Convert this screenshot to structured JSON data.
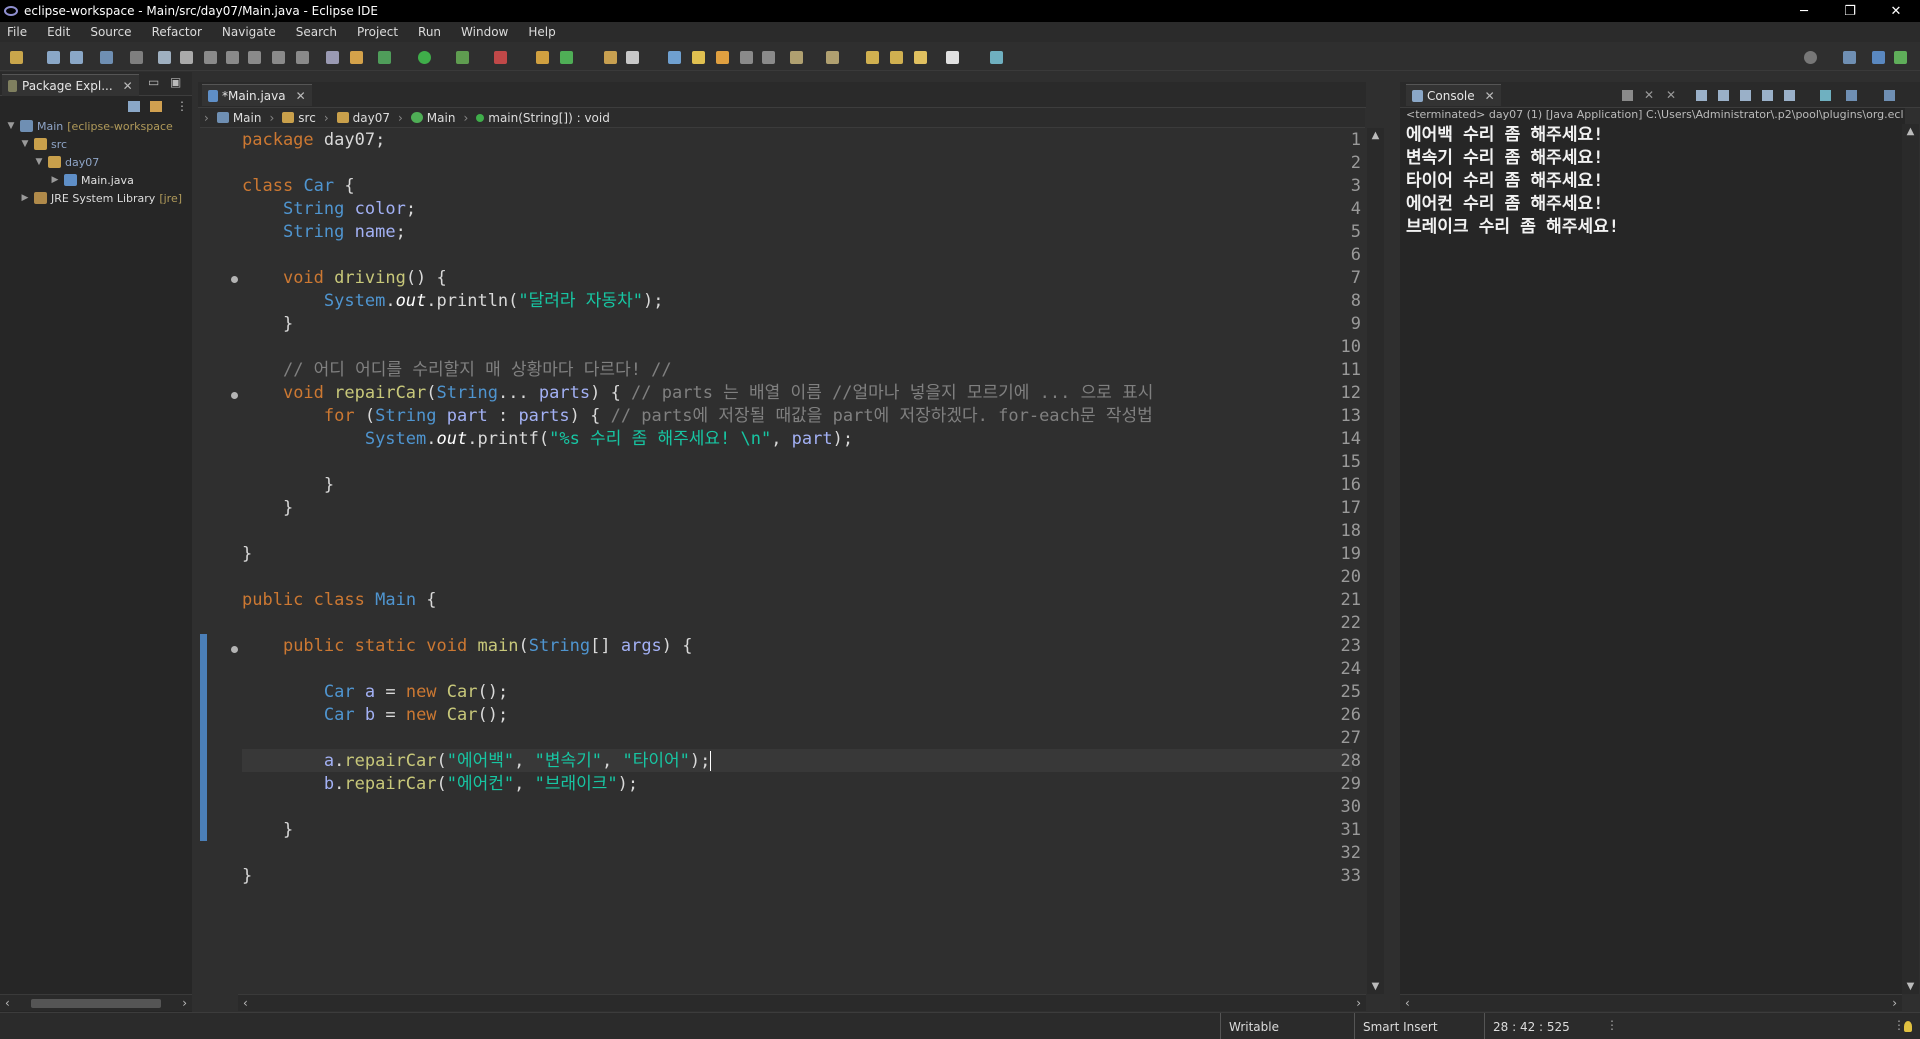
{
  "window": {
    "title": "eclipse-workspace - Main/src/day07/Main.java - Eclipse IDE",
    "minimize_glyph": "─",
    "restore_glyph": "❐",
    "close_glyph": "✕"
  },
  "menu": [
    "File",
    "Edit",
    "Source",
    "Refactor",
    "Navigate",
    "Search",
    "Project",
    "Run",
    "Window",
    "Help"
  ],
  "package_explorer": {
    "tab_label": "Package Expl...",
    "tree": [
      {
        "label": "Main",
        "suffix": "[eclipse-workspace",
        "icon": "project-icon"
      },
      {
        "label": "src",
        "icon": "source-folder-icon"
      },
      {
        "label": "day07",
        "icon": "package-icon"
      },
      {
        "label": "Main.java",
        "icon": "java-file-icon"
      },
      {
        "label": "JRE System Library",
        "suffix": "[jre]",
        "icon": "library-icon"
      }
    ]
  },
  "editor": {
    "tab_label": "*Main.java",
    "breadcrumb": [
      "Main",
      "src",
      "day07",
      "Main",
      "main(String[]) : void"
    ],
    "current_line": 28
  },
  "console": {
    "tab_label": "Console",
    "header": "<terminated> day07 (1) [Java Application] C:\\Users\\Administrator\\.p2\\pool\\plugins\\org.ecl",
    "output": [
      "에어백 수리 좀 해주세요!",
      "변속기 수리 좀 해주세요!",
      "타이어 수리 좀 해주세요!",
      "에어컨 수리 좀 해주세요!",
      "브레이크 수리 좀 해주세요!"
    ]
  },
  "status": {
    "writable": "Writable",
    "insert_mode": "Smart Insert",
    "position": "28 : 42 : 525"
  },
  "colors": {
    "keyword": "#cc7832",
    "type": "#4f95d0",
    "string": "#17c6a3",
    "comment": "#808080"
  }
}
